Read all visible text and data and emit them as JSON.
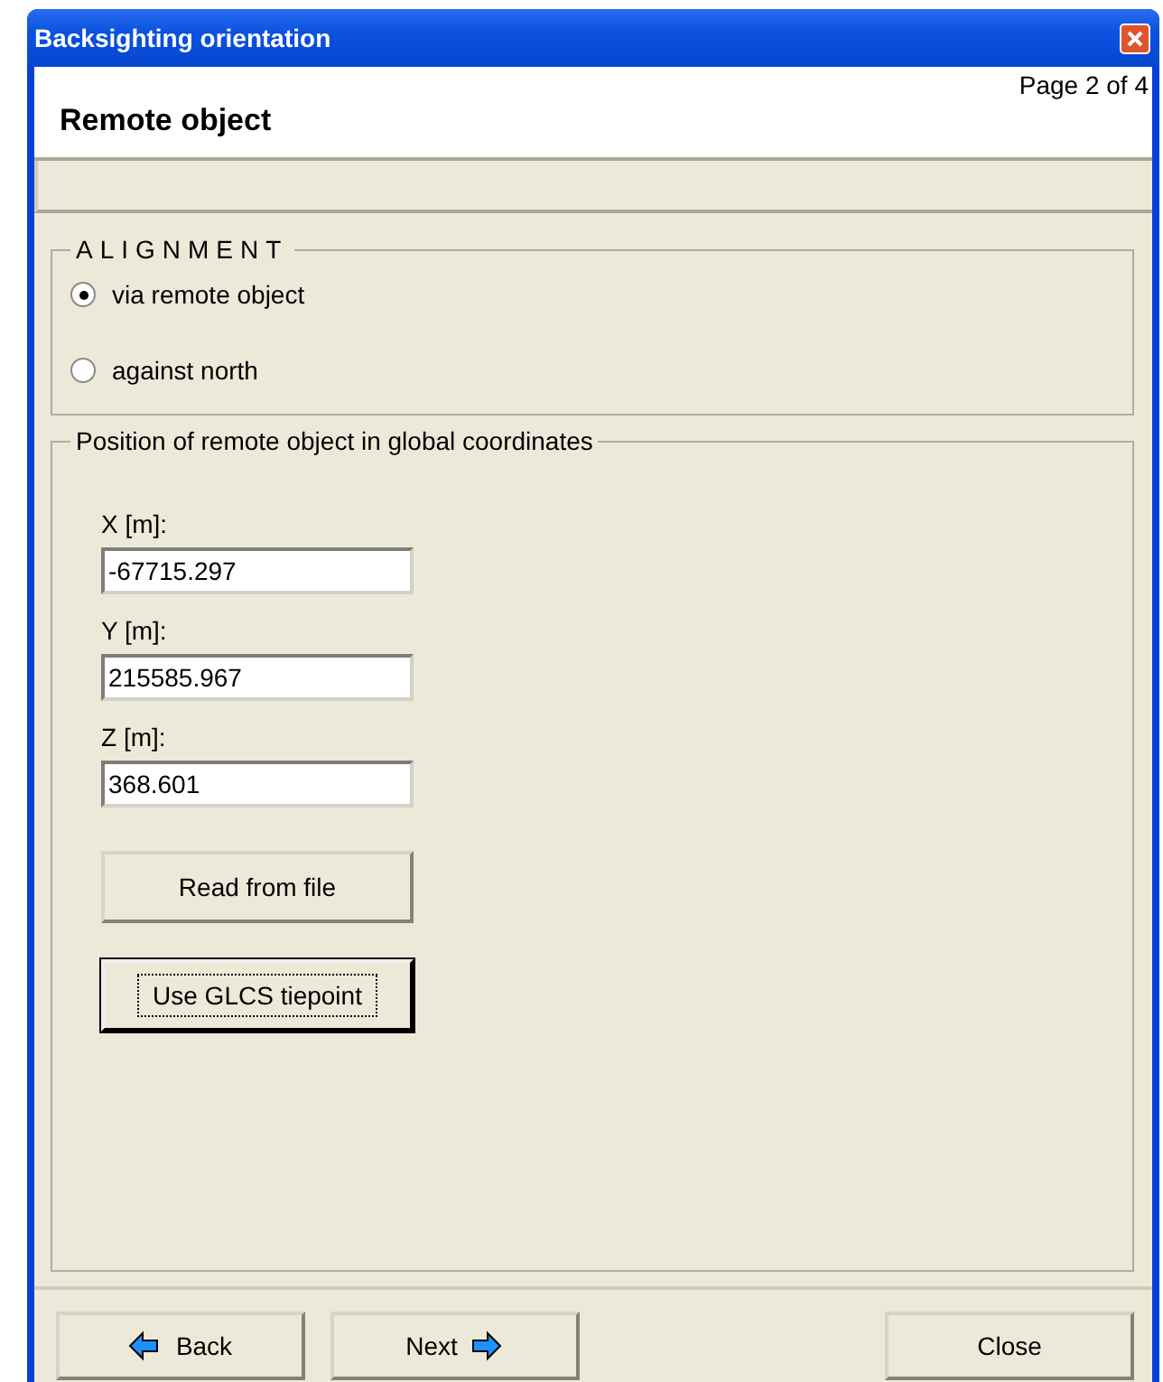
{
  "window": {
    "title": "Backsighting orientation"
  },
  "header": {
    "page": "Page 2 of 4",
    "title": "Remote object"
  },
  "alignment": {
    "legend": "ALIGNMENT",
    "options": [
      {
        "label": "via remote object",
        "selected": true
      },
      {
        "label": "against north",
        "selected": false
      }
    ]
  },
  "position": {
    "legend": "Position of remote object in global coordinates",
    "fields": [
      {
        "label": "X [m]:",
        "value": "-67715.297"
      },
      {
        "label": "Y [m]:",
        "value": "215585.967"
      },
      {
        "label": "Z [m]:",
        "value": "368.601"
      }
    ],
    "buttons": [
      {
        "label": "Read from file",
        "focused": false
      },
      {
        "label": "Use GLCS tiepoint",
        "focused": true
      }
    ]
  },
  "footer": [
    {
      "label": "Back",
      "kind": "back"
    },
    {
      "label": "Next",
      "kind": "next"
    },
    {
      "label": "Close",
      "kind": "close"
    }
  ]
}
